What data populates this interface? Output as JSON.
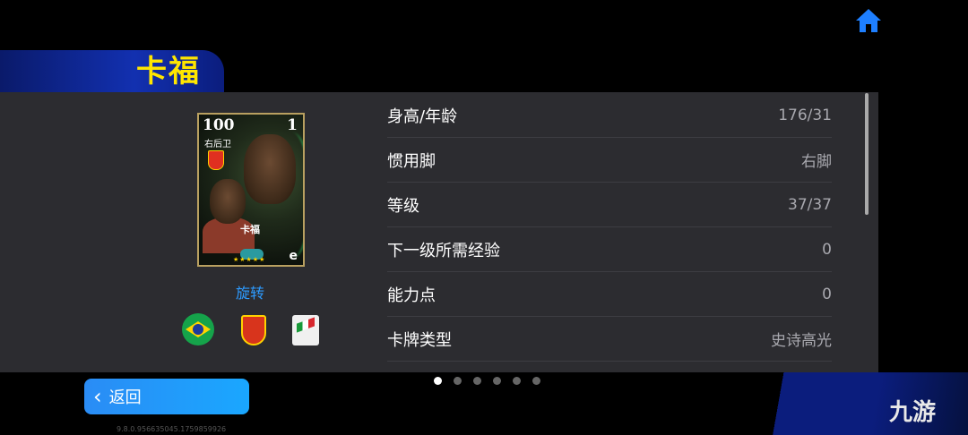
{
  "header": {
    "player_name": "卡福",
    "home_icon": "home-icon"
  },
  "card": {
    "rating": "100",
    "level": "1",
    "position": "右后卫",
    "name": "卡福",
    "stars": "★★★★★",
    "brand": "e"
  },
  "rotate_label": "旋转",
  "badges": [
    "brazil-flag-icon",
    "club-crest-icon",
    "league-logo-icon"
  ],
  "stats": [
    {
      "label": "身高/年龄",
      "value": "176/31"
    },
    {
      "label": "惯用脚",
      "value": "右脚"
    },
    {
      "label": "等级",
      "value": "37/37"
    },
    {
      "label": "下一级所需经验",
      "value": "0"
    },
    {
      "label": "能力点",
      "value": "0"
    },
    {
      "label": "卡牌类型",
      "value": "史诗高光"
    }
  ],
  "back_button": {
    "label": "返回"
  },
  "pagination": {
    "count": 6,
    "active": 0
  },
  "version_text": "9.8.0.956635045.1759859926",
  "watermark": "九游",
  "colors": {
    "title": "#ffe600",
    "accent": "#2d9bff",
    "panel": "#2c2c30"
  }
}
